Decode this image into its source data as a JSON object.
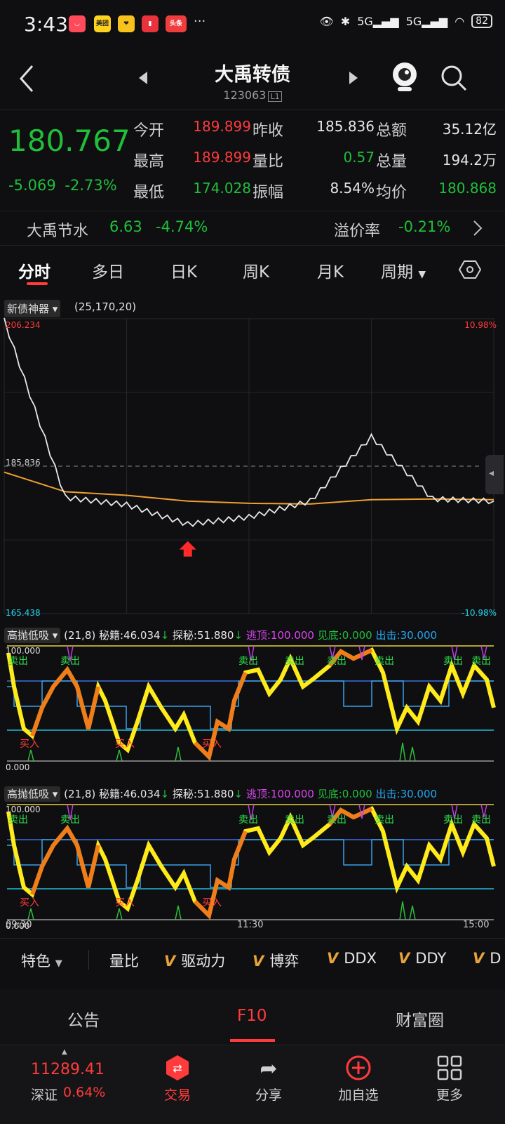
{
  "status": {
    "time": "3:43",
    "apps": [
      "美团",
      "头条"
    ],
    "signal": "5G",
    "battery": "82",
    "more": "···"
  },
  "header": {
    "title": "大禹转债",
    "code": "123063",
    "level": "L1"
  },
  "quote": {
    "price": "180.767",
    "change": "-5.069",
    "change_pct": "-2.73%",
    "rows": [
      {
        "l1": "今开",
        "v1": "189.899",
        "l2": "昨收",
        "v2": "185.836",
        "l3": "总额",
        "v3": "35.12亿"
      },
      {
        "l1": "最高",
        "v1": "189.899",
        "l2": "量比",
        "v2": "0.57",
        "l3": "总量",
        "v3": "194.2万"
      },
      {
        "l1": "最低",
        "v1": "174.028",
        "l2": "振幅",
        "v2": "8.54%",
        "l3": "均价",
        "v3": "180.868"
      }
    ]
  },
  "underlying": {
    "name": "大禹节水",
    "price": "6.63",
    "pct": "-4.74%",
    "premium_label": "溢价率",
    "premium": "-0.21%"
  },
  "tabs": [
    "分时",
    "多日",
    "日K",
    "周K",
    "月K",
    "周期"
  ],
  "chart": {
    "indicator": "新债神器",
    "params": "(25,170,20)",
    "y_top": "206.234",
    "y_bottom": "165.438",
    "y_ref": "185.836",
    "pct_top": "10.98%",
    "pct_bottom": "-10.98%",
    "time_labels": [
      "09:30",
      "11:30",
      "15:00"
    ]
  },
  "chart_data": {
    "type": "line",
    "x": [
      "09:30",
      "10:00",
      "10:30",
      "11:00",
      "11:30",
      "13:30",
      "14:00",
      "14:30",
      "15:00"
    ],
    "series": [
      {
        "values": [
          206.0,
          181.5,
          180.5,
          177.8,
          178.8,
          181.0,
          189.9,
          181.3,
          181.0
        ]
      },
      {
        "values": [
          185.0,
          182.3,
          181.8,
          181.0,
          180.7,
          180.6,
          181.2,
          181.3,
          181.2
        ]
      }
    ],
    "reference": 185.836,
    "ylim": [
      165.438,
      206.234
    ],
    "grid": true
  },
  "indicators": [
    {
      "name": "高抛低吸",
      "params": "(21,8)",
      "mj_label": "秘籍:",
      "mj": "46.034",
      "ts_label": "探秘:",
      "ts": "51.880",
      "td_label": "逃顶:",
      "td": "100.000",
      "jd_label": "见底:",
      "jd": "0.000",
      "cj_label": "出击:",
      "cj": "30.000",
      "top": "100.000",
      "bottom": "0.000",
      "sell": "卖出",
      "buy": "买入"
    },
    {
      "name": "高抛低吸",
      "params": "(21,8)",
      "mj_label": "秘籍:",
      "mj": "46.034",
      "ts_label": "探秘:",
      "ts": "51.880",
      "td_label": "逃顶:",
      "td": "100.000",
      "jd_label": "见底:",
      "jd": "0.000",
      "cj_label": "出击:",
      "cj": "30.000",
      "top": "100.000",
      "bottom": "0.000",
      "sell": "卖出",
      "buy": "买入"
    }
  ],
  "featbar": {
    "special": "特色",
    "items": [
      "量比",
      "驱动力",
      "博弈",
      "DDX",
      "DDY",
      "D"
    ]
  },
  "tabs2": [
    "公告",
    "F10",
    "财富圈"
  ],
  "dock": {
    "index_value": "11289.41",
    "index_name": "深证",
    "index_pct": "0.64%",
    "items": [
      "交易",
      "分享",
      "加自选",
      "更多"
    ]
  },
  "colors": {
    "up": "#ff3b3b",
    "down": "#1fbf3a",
    "price_line": "#e8e8e8",
    "avg_line": "#f0a030"
  }
}
